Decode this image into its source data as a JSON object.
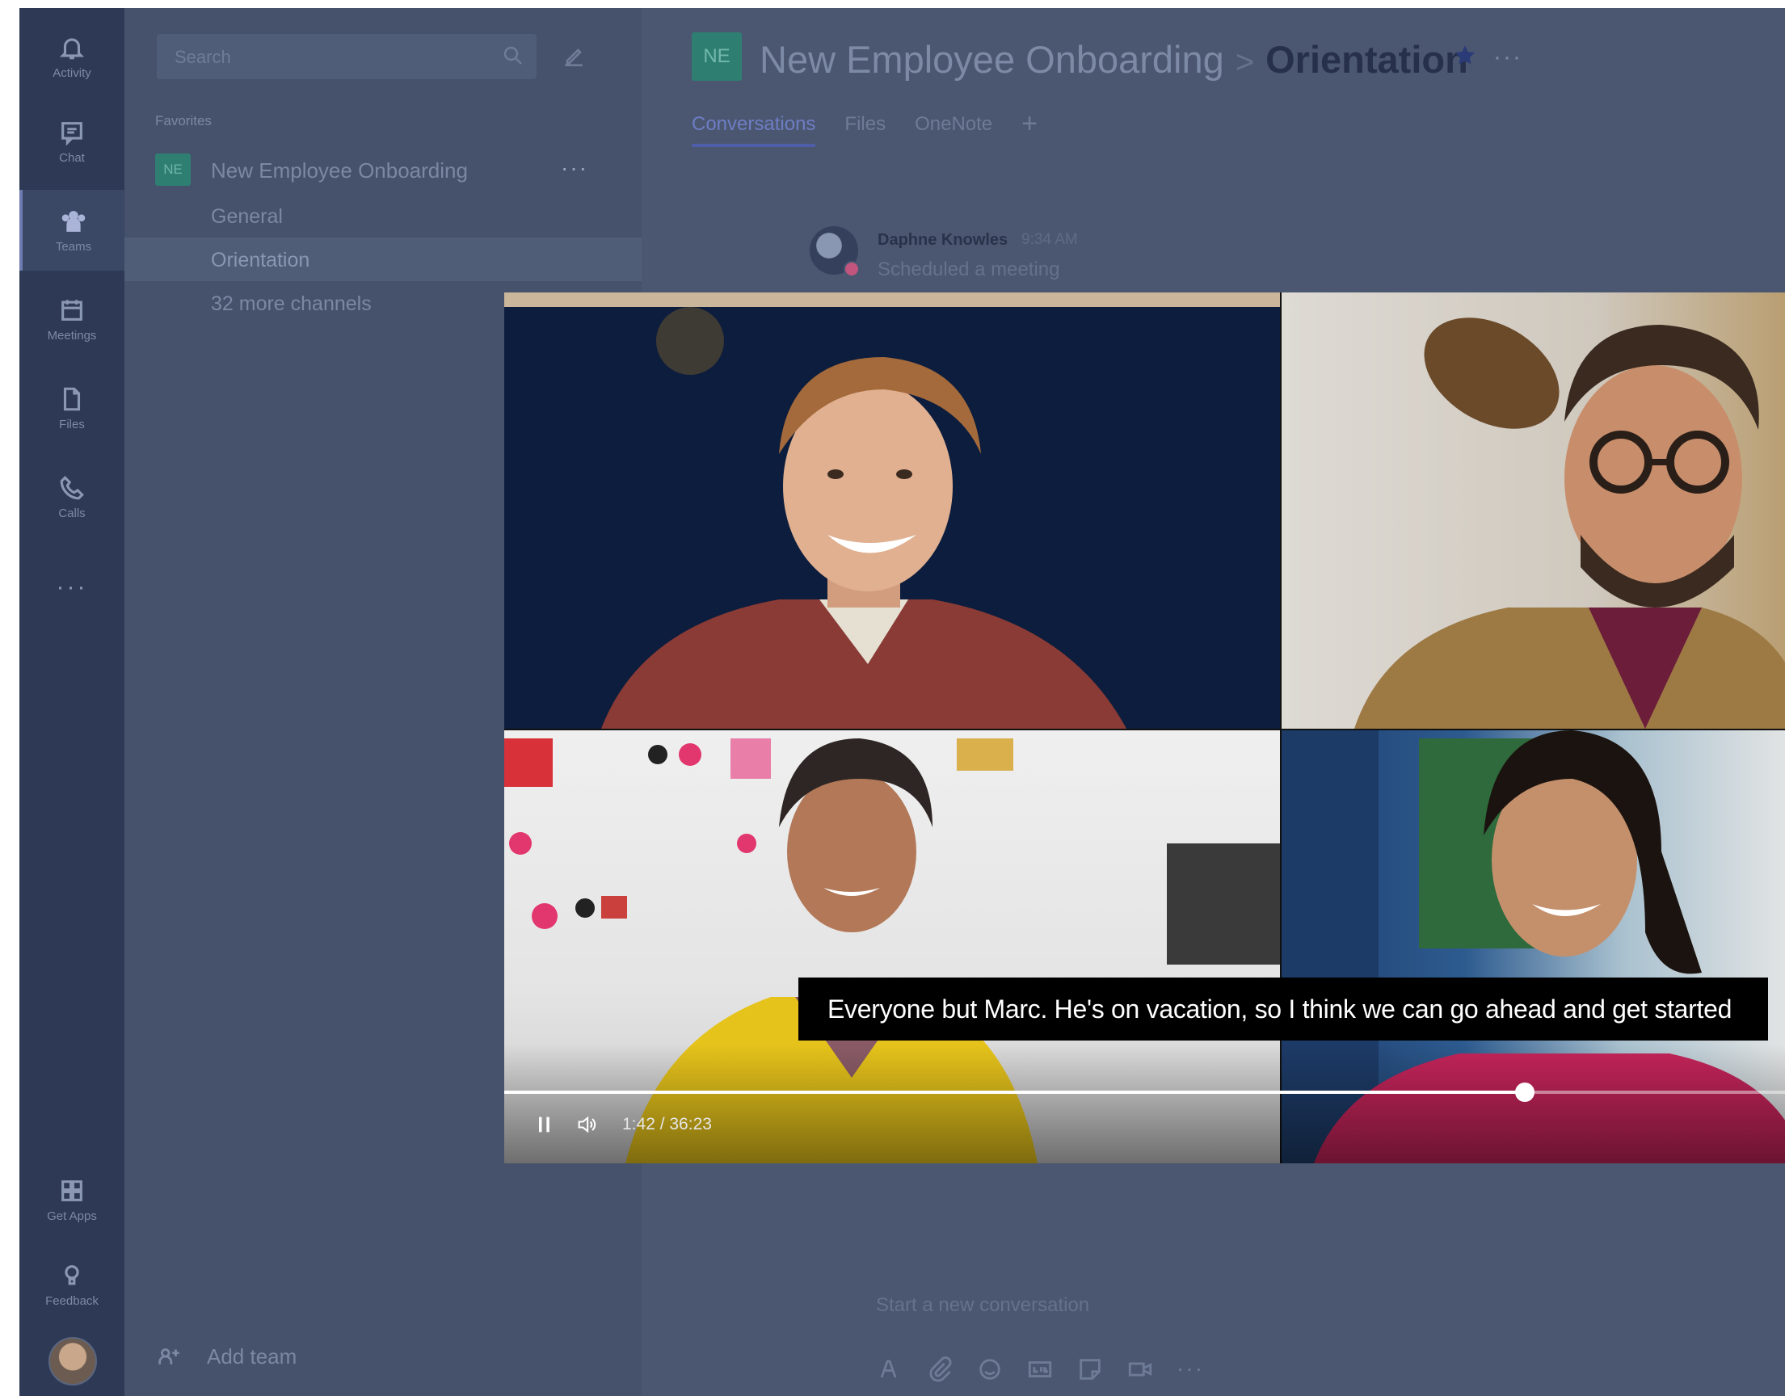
{
  "rail": {
    "items": [
      {
        "label": "Activity",
        "icon": "bell-icon"
      },
      {
        "label": "Chat",
        "icon": "chat-icon"
      },
      {
        "label": "Teams",
        "icon": "teams-icon"
      },
      {
        "label": "Meetings",
        "icon": "calendar-icon"
      },
      {
        "label": "Files",
        "icon": "file-icon"
      },
      {
        "label": "Calls",
        "icon": "phone-icon"
      }
    ],
    "more": "···",
    "bottom": [
      {
        "label": "Get Apps",
        "icon": "apps-icon"
      },
      {
        "label": "Feedback",
        "icon": "lightbulb-icon"
      }
    ]
  },
  "sidebar": {
    "search_placeholder": "Search",
    "favorites_label": "Favorites",
    "team": {
      "initials": "NE",
      "name": "New Employee Onboarding",
      "more": "···"
    },
    "channels": [
      "General",
      "Orientation",
      "32 more channels"
    ],
    "add_team": "Add team"
  },
  "header": {
    "team_initials": "NE",
    "team_name": "New Employee Onboarding",
    "separator": ">",
    "channel": "Orientation",
    "more": "···",
    "tabs": [
      "Conversations",
      "Files",
      "OneNote"
    ],
    "tab_add": "+"
  },
  "message": {
    "author": "Daphne Knowles",
    "time": "9:34 AM",
    "text": "Scheduled a meeting"
  },
  "compose": {
    "placeholder": "Start a new conversation",
    "tools": [
      "format-icon",
      "attach-icon",
      "emoji-icon",
      "gif-icon",
      "sticker-icon",
      "meet-icon",
      "more-icon"
    ],
    "more": "···"
  },
  "video": {
    "caption": "Everyone but Marc. He's on vacation, so I think we can go ahead and get started",
    "timecode": "1:42 / 36:23",
    "progress": 0.785
  },
  "colors": {
    "rail_bg": "#2e3a55",
    "list_bg": "#46526b",
    "main_bg": "#4b5770",
    "team_tile": "#2e7f72",
    "accent": "#4e5ea8"
  }
}
